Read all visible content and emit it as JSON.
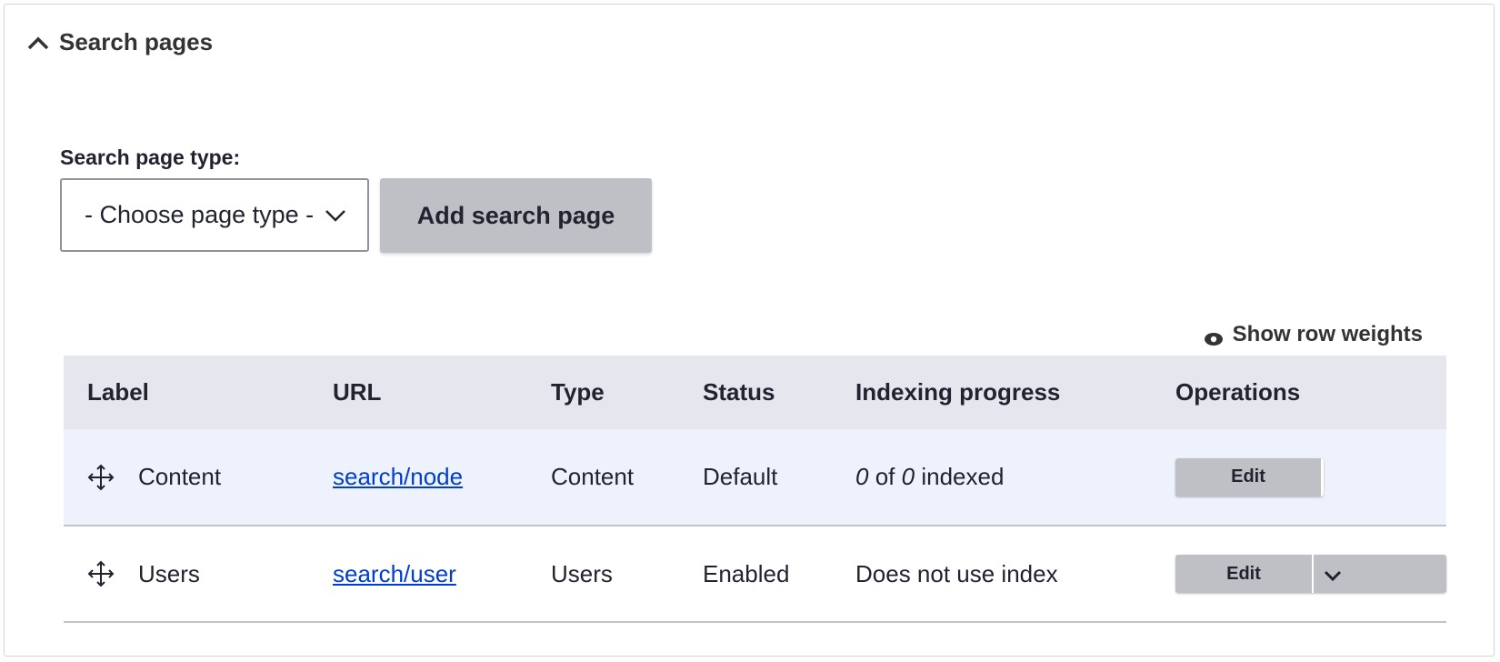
{
  "section": {
    "title": "Search pages"
  },
  "form": {
    "type_label": "Search page type:",
    "type_selected": "- Choose page type -",
    "add_button": "Add search page"
  },
  "table": {
    "show_row_weights": "Show row weights",
    "headers": [
      "Label",
      "URL",
      "Type",
      "Status",
      "Indexing progress",
      "Operations"
    ],
    "rows": [
      {
        "label": "Content",
        "url": "search/node",
        "type": "Content",
        "status": "Default",
        "progress_indexed": "0",
        "progress_of": "of",
        "progress_total": "0",
        "progress_suffix": "indexed",
        "operation": "Edit"
      },
      {
        "label": "Users",
        "url": "search/user",
        "type": "Users",
        "status": "Enabled",
        "progress_text": "Does not use index",
        "operation": "Edit"
      }
    ]
  },
  "icons": {
    "collapse": "chevron-up-icon",
    "select_arrow": "chevron-down-icon",
    "row_weights": "eye-icon",
    "drag": "drag-handle-icon",
    "ops_toggle": "chevron-down-icon"
  },
  "colors": {
    "link": "#003ecc",
    "button": "#bfc0c6",
    "header_bg": "#e6e7ee",
    "selected_row_bg": "#eef2fc"
  }
}
